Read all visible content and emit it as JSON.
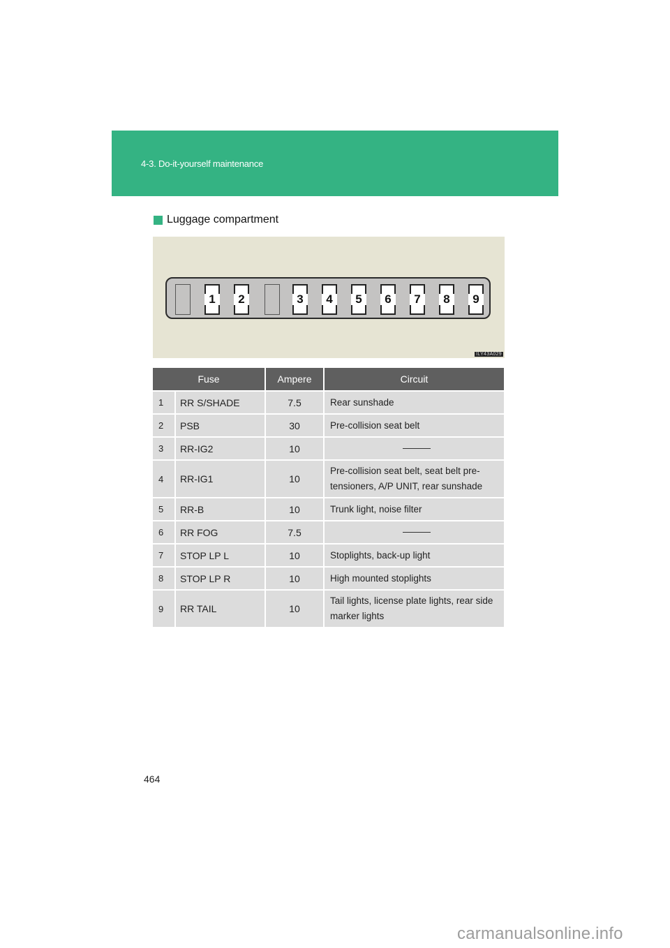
{
  "header": {
    "section": "4-3. Do-it-yourself maintenance"
  },
  "subheading": "Luggage compartment",
  "diagram": {
    "slots": [
      {
        "type": "empty",
        "label": ""
      },
      {
        "type": "fuse",
        "label": "1"
      },
      {
        "type": "fuse",
        "label": "2"
      },
      {
        "type": "empty",
        "label": ""
      },
      {
        "type": "fuse",
        "label": "3"
      },
      {
        "type": "fuse",
        "label": "4"
      },
      {
        "type": "fuse",
        "label": "5"
      },
      {
        "type": "fuse",
        "label": "6"
      },
      {
        "type": "fuse",
        "label": "7"
      },
      {
        "type": "fuse",
        "label": "8"
      },
      {
        "type": "fuse",
        "label": "9"
      }
    ],
    "code": "ILY43A029"
  },
  "table": {
    "headers": [
      "Fuse",
      "Ampere",
      "Circuit"
    ],
    "rows": [
      {
        "no": "1",
        "name": "RR S/SHADE",
        "amp": "7.5",
        "circuit": "Rear sunshade"
      },
      {
        "no": "2",
        "name": "PSB",
        "amp": "30",
        "circuit": "Pre-collision seat belt"
      },
      {
        "no": "3",
        "name": "RR-IG2",
        "amp": "10",
        "circuit": "—"
      },
      {
        "no": "4",
        "name": "RR-IG1",
        "amp": "10",
        "circuit": "Pre-collision seat belt, seat belt pre-tensioners, A/P UNIT, rear sunshade"
      },
      {
        "no": "5",
        "name": "RR-B",
        "amp": "10",
        "circuit": "Trunk light, noise filter"
      },
      {
        "no": "6",
        "name": "RR FOG",
        "amp": "7.5",
        "circuit": "—"
      },
      {
        "no": "7",
        "name": "STOP LP L",
        "amp": "10",
        "circuit": "Stoplights, back-up light"
      },
      {
        "no": "8",
        "name": "STOP LP R",
        "amp": "10",
        "circuit": "High mounted stoplights"
      },
      {
        "no": "9",
        "name": "RR TAIL",
        "amp": "10",
        "circuit": "Tail lights, license plate lights, rear side marker lights"
      }
    ]
  },
  "page_number": "464",
  "watermark": "carmanualsonline.info",
  "colors": {
    "accent": "#34b383",
    "table_header": "#5f5f5f",
    "table_cell": "#dcdcdc",
    "diagram_bg": "#e6e4d3"
  }
}
